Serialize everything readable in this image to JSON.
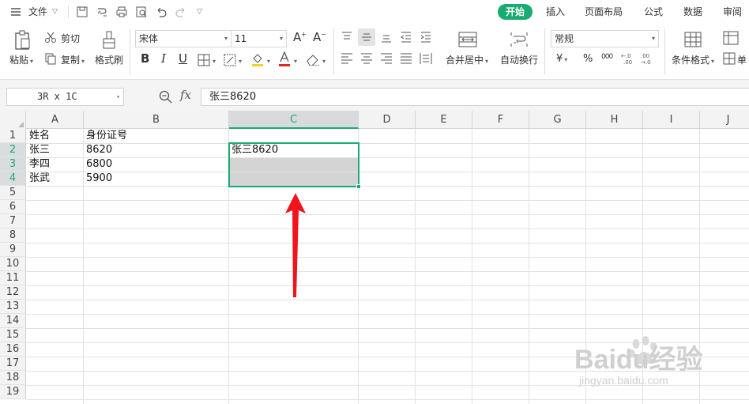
{
  "menubar": {
    "file_label": "文件",
    "tabs": [
      {
        "label": "开始",
        "active": true
      },
      {
        "label": "插入",
        "active": false
      },
      {
        "label": "页面布局",
        "active": false
      },
      {
        "label": "公式",
        "active": false
      },
      {
        "label": "数据",
        "active": false
      },
      {
        "label": "审阅",
        "active": false
      }
    ],
    "accent_color": "#1aab72"
  },
  "ribbon": {
    "paste_label": "粘贴",
    "cut_label": "剪切",
    "copy_label": "复制",
    "format_painter_label": "格式刷",
    "font_name": "宋体",
    "font_size": "11",
    "merge_center_label": "合并居中",
    "wrap_text_label": "自动换行",
    "number_format": "常规",
    "conditional_format_label": "条件格式",
    "cell_style_label": "单",
    "currency_symbol": "¥",
    "percent_symbol": "%",
    "thousands_symbol": "000"
  },
  "formula_bar": {
    "name_box": "3R x 1C",
    "fx_label": "fx",
    "formula": "张三8620"
  },
  "sheet": {
    "columns": [
      "A",
      "B",
      "C",
      "D",
      "E",
      "F",
      "G",
      "H",
      "I",
      "J"
    ],
    "rows": [
      "1",
      "2",
      "3",
      "4",
      "5",
      "6",
      "7",
      "8",
      "9",
      "10",
      "11",
      "12",
      "13",
      "14",
      "15",
      "16",
      "17",
      "18",
      "19"
    ],
    "cells": {
      "A1": "姓名",
      "B1": "身份证号",
      "A2": "张三",
      "B2": "8620",
      "C2": "张三8620",
      "A3": "李四",
      "B3": "6800",
      "A4": "张武",
      "B4": "5900"
    },
    "selected_range": "C2:C4",
    "selected_column": "C"
  },
  "watermark": {
    "brand": "Baidu经验",
    "url": "jingyan.baidu.com"
  }
}
